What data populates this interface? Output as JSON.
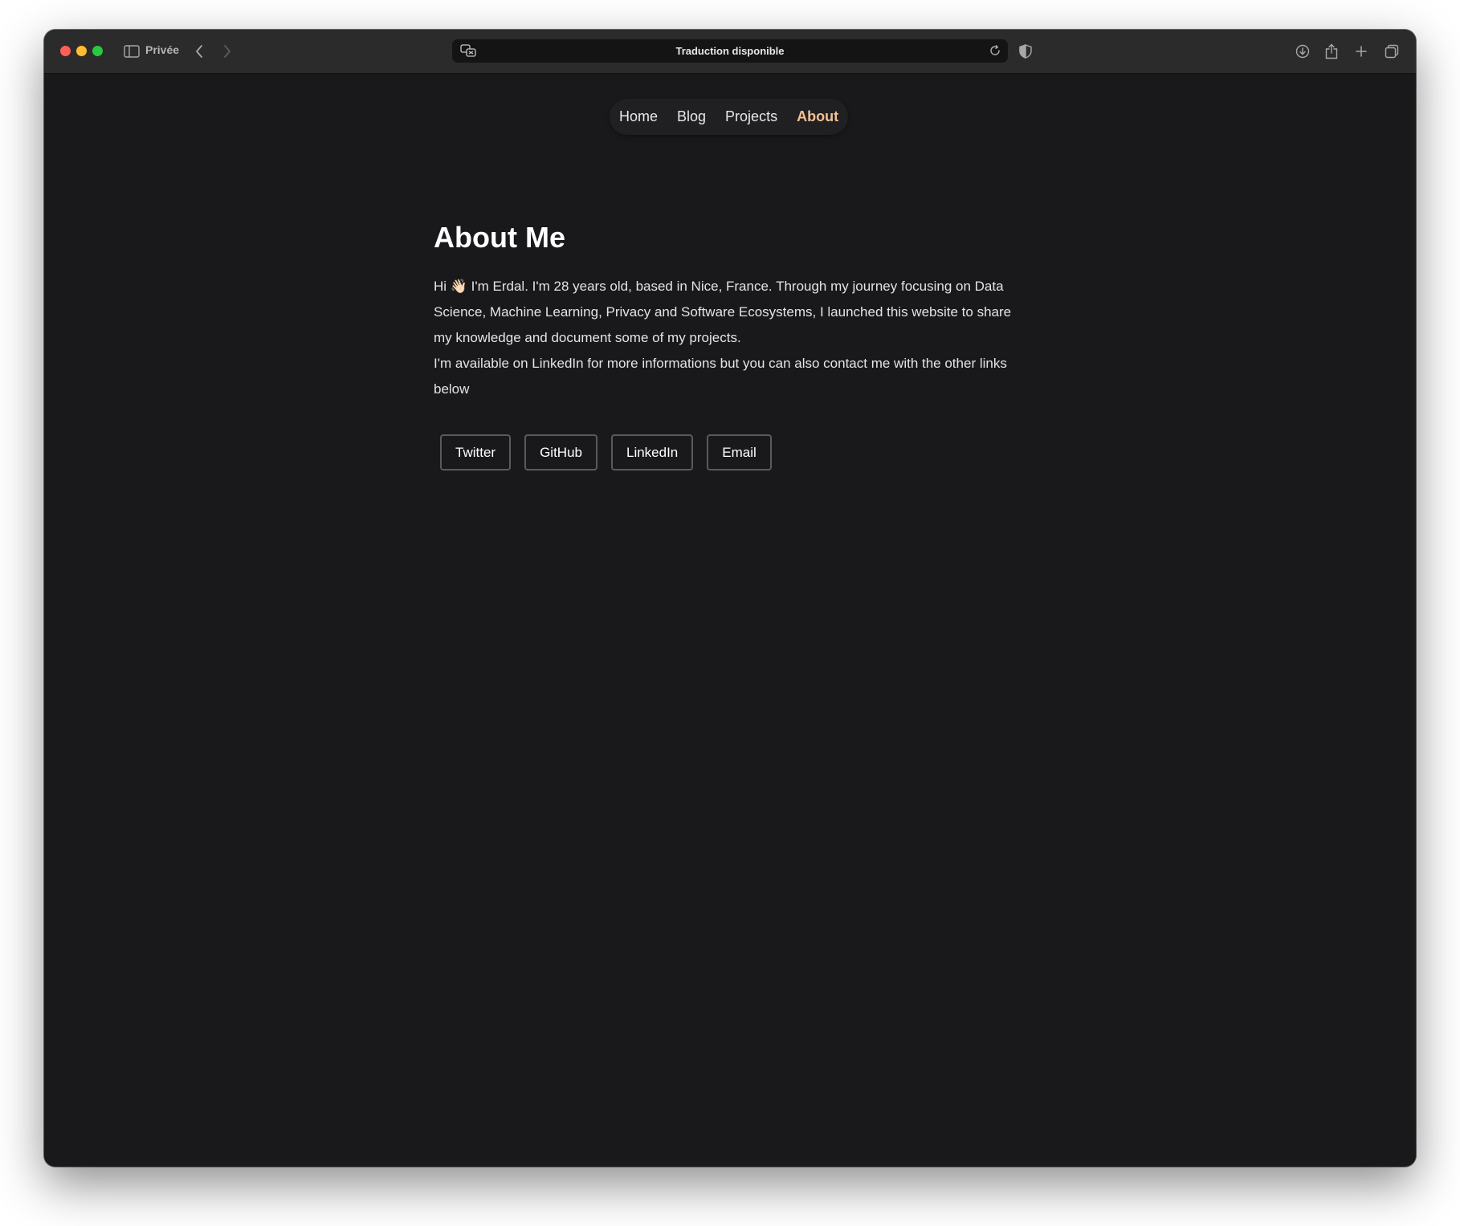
{
  "browser": {
    "private_label": "Privée",
    "address_text": "Traduction disponible"
  },
  "nav": {
    "items": [
      {
        "label": "Home"
      },
      {
        "label": "Blog"
      },
      {
        "label": "Projects"
      },
      {
        "label": "About",
        "active": true
      }
    ]
  },
  "main": {
    "title": "About Me",
    "bio_line1": "Hi 👋🏻 I'm Erdal. I'm 28 years old, based in Nice, France. Through my journey focusing on Data Science, Machine Learning, Privacy and Software Ecosystems, I launched this website to share my knowledge and document some of my projects.",
    "bio_line2": "I'm available on LinkedIn for more informations but you can also contact me with the other links below",
    "links": [
      {
        "label": "Twitter"
      },
      {
        "label": "GitHub"
      },
      {
        "label": "LinkedIn"
      },
      {
        "label": "Email"
      }
    ]
  },
  "colors": {
    "background": "#19191b",
    "nav_active": "#f3c193",
    "text": "#ffffff"
  }
}
